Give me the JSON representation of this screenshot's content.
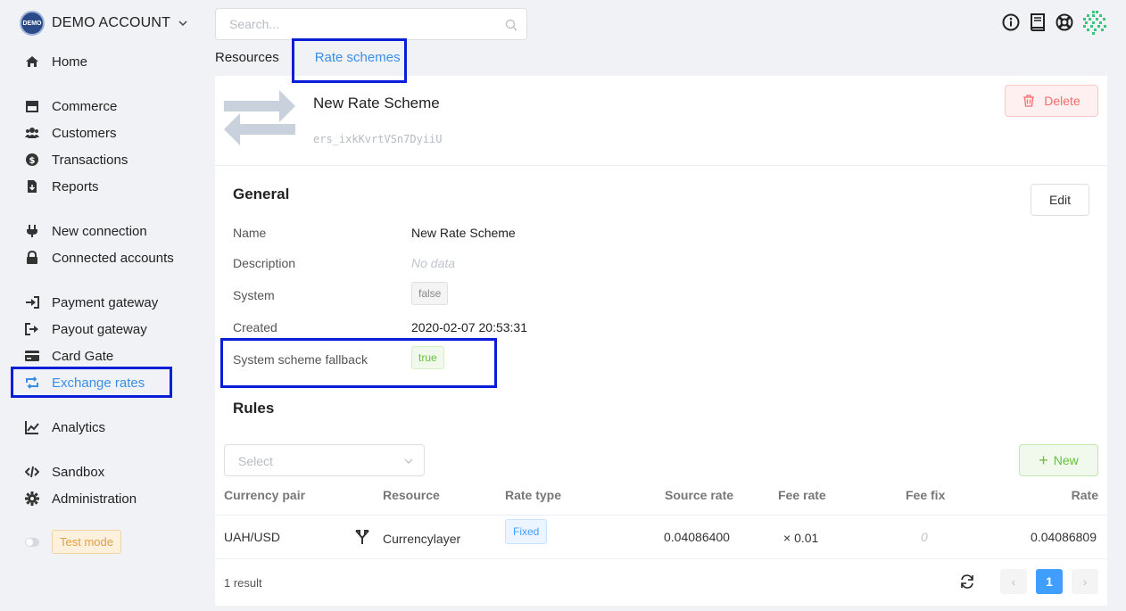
{
  "account": {
    "logo_text": "DEMO",
    "name": "DEMO ACCOUNT"
  },
  "search": {
    "placeholder": "Search..."
  },
  "nav": {
    "home": "Home",
    "commerce": "Commerce",
    "customers": "Customers",
    "transactions": "Transactions",
    "reports": "Reports",
    "new_connection": "New connection",
    "connected_accounts": "Connected accounts",
    "payment_gateway": "Payment gateway",
    "payout_gateway": "Payout gateway",
    "card_gate": "Card Gate",
    "exchange_rates": "Exchange rates",
    "analytics": "Analytics",
    "sandbox": "Sandbox",
    "administration": "Administration",
    "test_mode": "Test mode"
  },
  "tabs": {
    "resources": "Resources",
    "rate_schemes": "Rate schemes"
  },
  "scheme": {
    "title": "New Rate Scheme",
    "id": "ers_ixkKvrtVSn7DyiiU",
    "delete_label": "Delete"
  },
  "general": {
    "title": "General",
    "edit_label": "Edit",
    "fields": {
      "name_label": "Name",
      "name_value": "New Rate Scheme",
      "description_label": "Description",
      "description_value": "No data",
      "system_label": "System",
      "system_value": "false",
      "created_label": "Created",
      "created_value": "2020-02-07 20:53:31",
      "fallback_label": "System scheme fallback",
      "fallback_value": "true"
    }
  },
  "rules": {
    "title": "Rules",
    "select_placeholder": "Select",
    "new_label": "New",
    "columns": {
      "pair": "Currency pair",
      "resource": "Resource",
      "rate_type": "Rate type",
      "source_rate": "Source rate",
      "fee_rate": "Fee rate",
      "fee_fix": "Fee fix",
      "rate": "Rate"
    },
    "rows": [
      {
        "pair": "UAH/USD",
        "resource": "Currencylayer",
        "rate_type": "Fixed",
        "source_rate": "0.04086400",
        "fee_rate": "× 0.01",
        "fee_fix": "0",
        "rate": "0.04086809"
      }
    ],
    "result_count": "1 result",
    "current_page": "1"
  },
  "colors": {
    "accent": "#3a8ee6",
    "danger": "#f56c6c",
    "success": "#67c23a",
    "highlight": "#0a1ed8"
  }
}
